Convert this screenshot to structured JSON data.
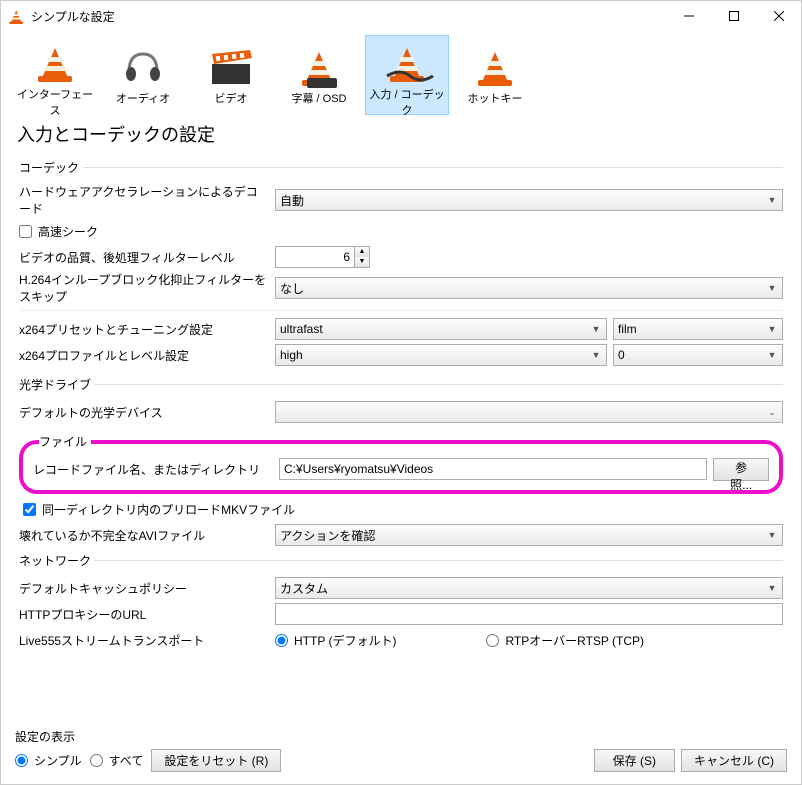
{
  "window": {
    "title": "シンプルな設定"
  },
  "tabs": {
    "interface": "インターフェース",
    "audio": "オーディオ",
    "video": "ビデオ",
    "subtitles": "字幕 / OSD",
    "input": "入力 / コーデック",
    "hotkeys": "ホットキー"
  },
  "heading": "入力とコーデックの設定",
  "codec": {
    "legend": "コーデック",
    "hwdecode_label": "ハードウェアアクセラレーションによるデコード",
    "hwdecode_value": "自動",
    "fastseek_label": "高速シーク",
    "quality_label": "ビデオの品質、後処理フィルターレベル",
    "quality_value": "6",
    "h264skip_label": "H.264インループブロック化抑止フィルターをスキップ",
    "h264skip_value": "なし",
    "x264preset_label": "x264プリセットとチューニング設定",
    "x264preset_a": "ultrafast",
    "x264preset_b": "film",
    "x264profile_label": "x264プロファイルとレベル設定",
    "x264profile_a": "high",
    "x264profile_b": "0"
  },
  "optical": {
    "legend": "光学ドライブ",
    "device_label": "デフォルトの光学デバイス",
    "device_value": ""
  },
  "file": {
    "legend": "ファイル",
    "record_label": "レコードファイル名、またはディレクトリ",
    "record_value": "C:¥Users¥ryomatsu¥Videos",
    "browse": "参照...",
    "preload_label": "同一ディレクトリ内のプリロードMKVファイル",
    "broken_label": "壊れているか不完全なAVIファイル",
    "broken_value": "アクションを確認"
  },
  "network": {
    "legend": "ネットワーク",
    "cache_label": "デフォルトキャッシュポリシー",
    "cache_value": "カスタム",
    "proxy_label": "HTTPプロキシーのURL",
    "proxy_value": "",
    "live555_label": "Live555ストリームトランスポート",
    "radio_http": "HTTP (デフォルト)",
    "radio_rtp": "RTPオーバーRTSP (TCP)"
  },
  "footer": {
    "show_label": "設定の表示",
    "simple": "シンプル",
    "all": "すべて",
    "reset": "設定をリセット (R)",
    "save": "保存 (S)",
    "cancel": "キャンセル (C)"
  }
}
